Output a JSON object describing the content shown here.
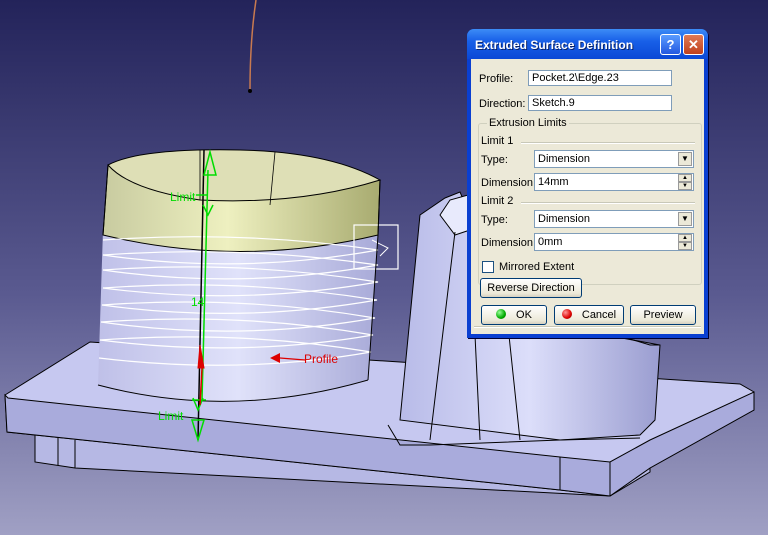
{
  "viewport": {
    "annotations": {
      "limit_top": "Limit",
      "limit_bottom": "Limit",
      "dimension": "14",
      "profile": "Profile"
    }
  },
  "dialog": {
    "title": "Extruded Surface Definition",
    "help_icon": "help-icon",
    "close_icon": "close-icon",
    "profile_label": "Profile:",
    "profile_value": "Pocket.2\\Edge.23",
    "direction_label": "Direction:",
    "direction_value": "Sketch.9",
    "extrusion_limits_title": "Extrusion Limits",
    "limit1": {
      "title": "Limit 1",
      "type_label": "Type:",
      "type_value": "Dimension",
      "dimension_label": "Dimension:",
      "dimension_value": "14mm"
    },
    "limit2": {
      "title": "Limit 2",
      "type_label": "Type:",
      "type_value": "Dimension",
      "dimension_label": "Dimension:",
      "dimension_value": "0mm"
    },
    "mirrored_label": "Mirrored Extent",
    "mirrored_checked": false,
    "reverse_label": "Reverse Direction",
    "ok_label": "OK",
    "cancel_label": "Cancel",
    "preview_label": "Preview"
  },
  "colors": {
    "background_top": "#23235a",
    "background_bottom": "#a0a0c4",
    "part_fill": "#c4c6ee",
    "surface_fill": "#dcdfa8",
    "annotation_green": "#00dd00",
    "annotation_red": "#dd0000",
    "title_blue": "#0a48d6"
  }
}
